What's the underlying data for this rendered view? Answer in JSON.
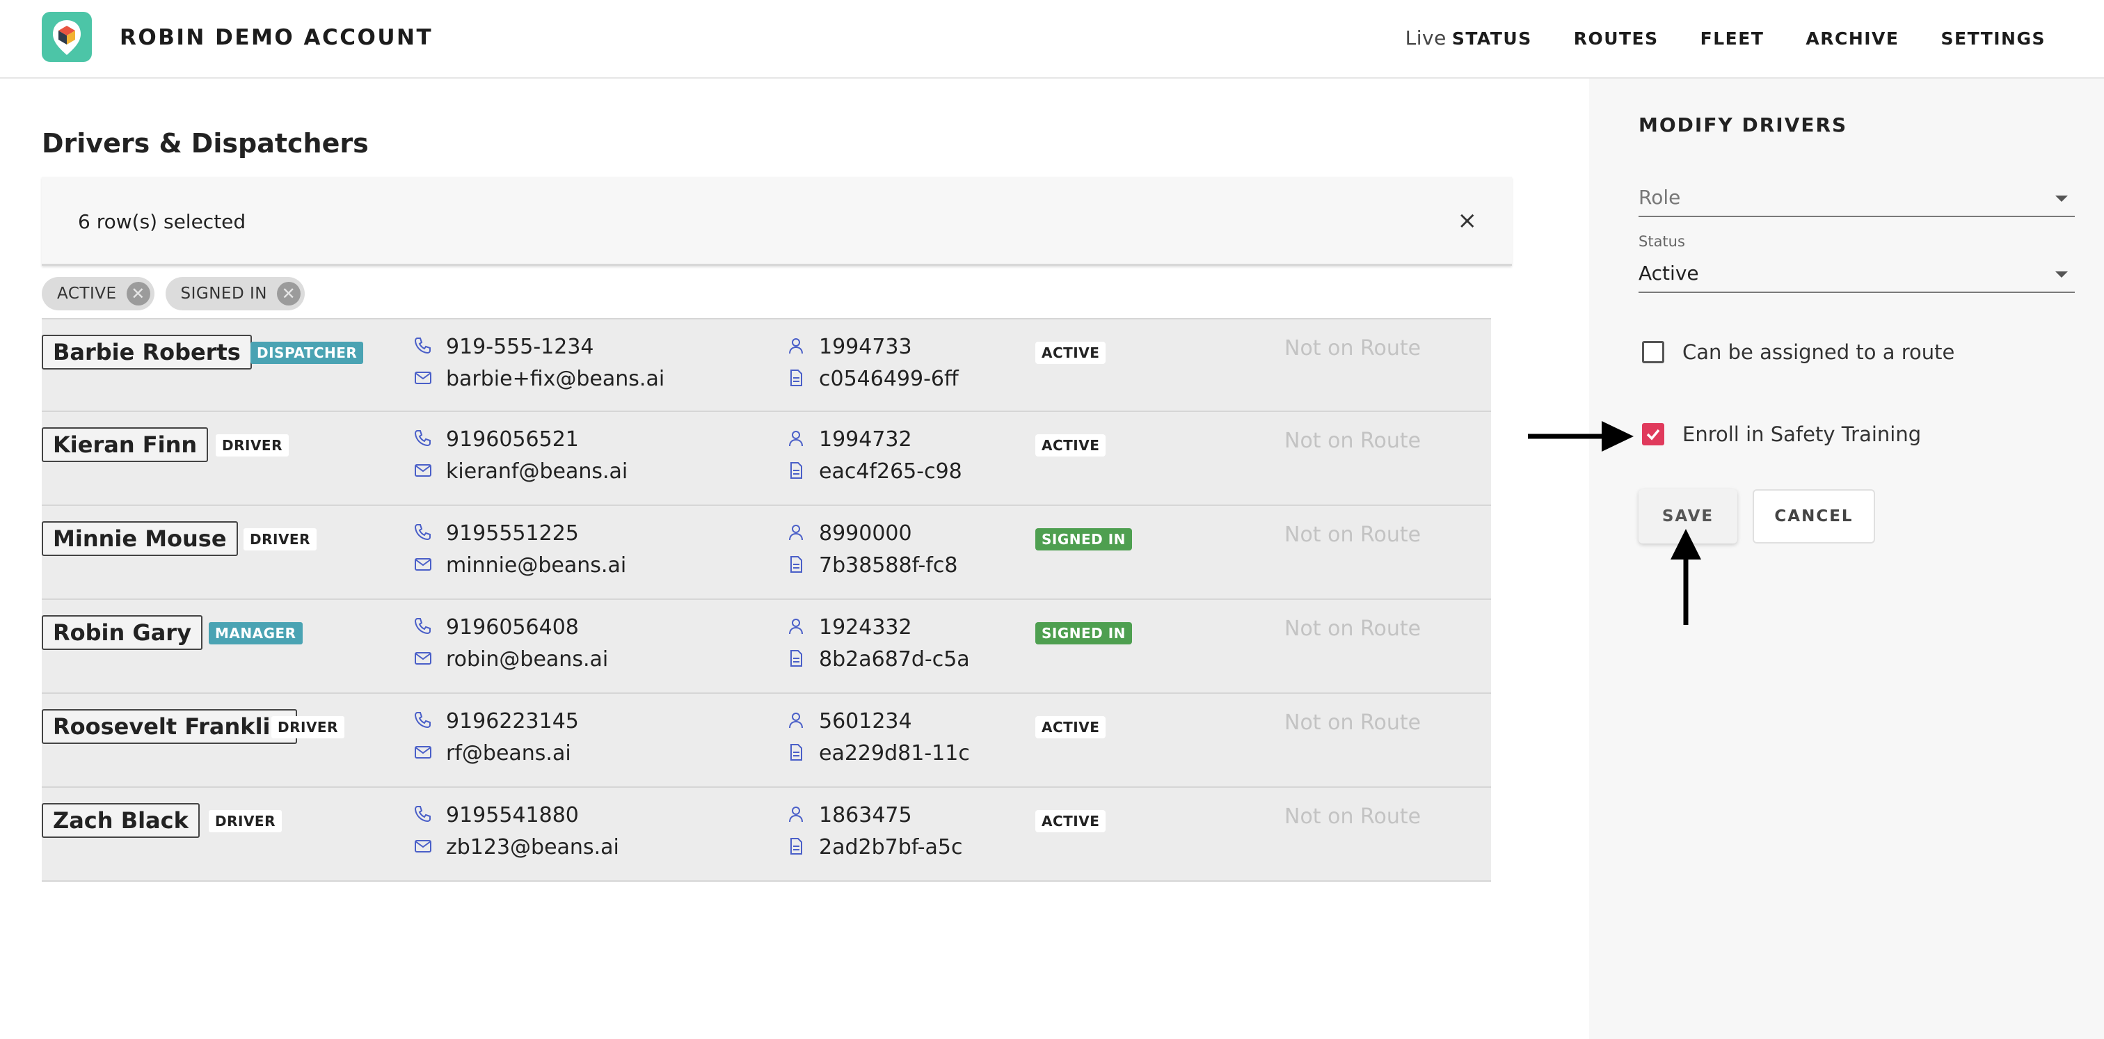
{
  "header": {
    "account_title": "ROBIN DEMO ACCOUNT",
    "nav": [
      {
        "prefix": "Live",
        "label": "STATUS"
      },
      {
        "label": "ROUTES"
      },
      {
        "label": "FLEET"
      },
      {
        "label": "ARCHIVE"
      },
      {
        "label": "SETTINGS"
      }
    ]
  },
  "main": {
    "title": "Drivers & Dispatchers",
    "selection_text": "6 row(s) selected",
    "close_symbol": "×",
    "filters": [
      "ACTIVE",
      "SIGNED IN"
    ],
    "rows": [
      {
        "name": "Barbie Roberts",
        "role": "DISPATCHER",
        "role_style": "teal",
        "phone": "919-555-1234",
        "email": "barbie+fix@beans.ai",
        "id": "1994733",
        "code": "c0546499-6ff",
        "status": "ACTIVE",
        "status_style": "active",
        "route": "Not on Route"
      },
      {
        "name": "Kieran Finn",
        "role": "DRIVER",
        "role_style": "plain",
        "phone": "9196056521",
        "email": "kieranf@beans.ai",
        "id": "1994732",
        "code": "eac4f265-c98",
        "status": "ACTIVE",
        "status_style": "active",
        "route": "Not on Route"
      },
      {
        "name": "Minnie Mouse",
        "role": "DRIVER",
        "role_style": "plain",
        "phone": "9195551225",
        "email": "minnie@beans.ai",
        "id": "8990000",
        "code": "7b38588f-fc8",
        "status": "SIGNED IN",
        "status_style": "signed",
        "route": "Not on Route"
      },
      {
        "name": "Robin Gary",
        "role": "MANAGER",
        "role_style": "teal",
        "phone": "9196056408",
        "email": "robin@beans.ai",
        "id": "1924332",
        "code": "8b2a687d-c5a",
        "status": "SIGNED IN",
        "status_style": "signed",
        "route": "Not on Route"
      },
      {
        "name": "Roosevelt Franklin",
        "role": "DRIVER",
        "role_style": "plain",
        "phone": "9196223145",
        "email": "rf@beans.ai",
        "id": "5601234",
        "code": "ea229d81-11c",
        "status": "ACTIVE",
        "status_style": "active",
        "route": "Not on Route"
      },
      {
        "name": "Zach Black",
        "role": "DRIVER",
        "role_style": "plain",
        "phone": "9195541880",
        "email": "zb123@beans.ai",
        "id": "1863475",
        "code": "2ad2b7bf-a5c",
        "status": "ACTIVE",
        "status_style": "active",
        "route": "Not on Route"
      }
    ]
  },
  "panel": {
    "title": "MODIFY DRIVERS",
    "role_placeholder": "Role",
    "status_label": "Status",
    "status_value": "Active",
    "checkbox_route_label": "Can be assigned to a route",
    "checkbox_route_checked": false,
    "checkbox_safety_label": "Enroll in Safety Training",
    "checkbox_safety_checked": true,
    "save_label": "SAVE",
    "cancel_label": "CANCEL"
  },
  "colors": {
    "logo_bg": "#4cc5a7",
    "teal_badge": "#4aa3b3",
    "signed_in_badge": "#4e9f50",
    "checkbox_checked": "#e03a5c",
    "icon_blue": "#4a5fc8"
  },
  "icons": [
    "app-logo-icon",
    "close-icon",
    "chip-remove-icon",
    "phone-icon",
    "mail-icon",
    "person-icon",
    "document-icon",
    "dropdown-caret-icon",
    "checkmark-icon",
    "arrow-right-icon",
    "arrow-up-icon"
  ]
}
